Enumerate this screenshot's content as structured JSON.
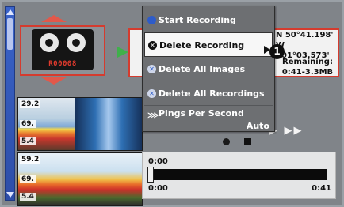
{
  "menu": {
    "items": [
      {
        "label": "Start Recording",
        "icon": "circle-icon"
      },
      {
        "label": "Delete Recording",
        "icon": "delete-x-icon",
        "selected": true
      },
      {
        "label": "Delete All Images",
        "icon": "delete-images-icon"
      },
      {
        "label": "Delete All Recordings",
        "icon": "delete-recordings-icon"
      },
      {
        "label": "Pings Per Second",
        "icon": "pings-icon"
      }
    ],
    "pings_value": "Auto"
  },
  "recording": {
    "label": "R00008"
  },
  "info": {
    "lat": "N 50°41.198'",
    "lon": "W 001°03.573'",
    "remaining_label": "Remaining:",
    "remaining_value": "0:41-3.3MB"
  },
  "thumbnail1": {
    "readings": [
      "29.2",
      "69.",
      "5.4"
    ]
  },
  "thumbnail2": {
    "readings": [
      "59.2",
      "69.",
      "5.4"
    ]
  },
  "playback": {
    "start": "0:00",
    "time_left": "0:00",
    "time_right": "0:41",
    "controls_label": "▶ ▶▶"
  },
  "callout": "1"
}
